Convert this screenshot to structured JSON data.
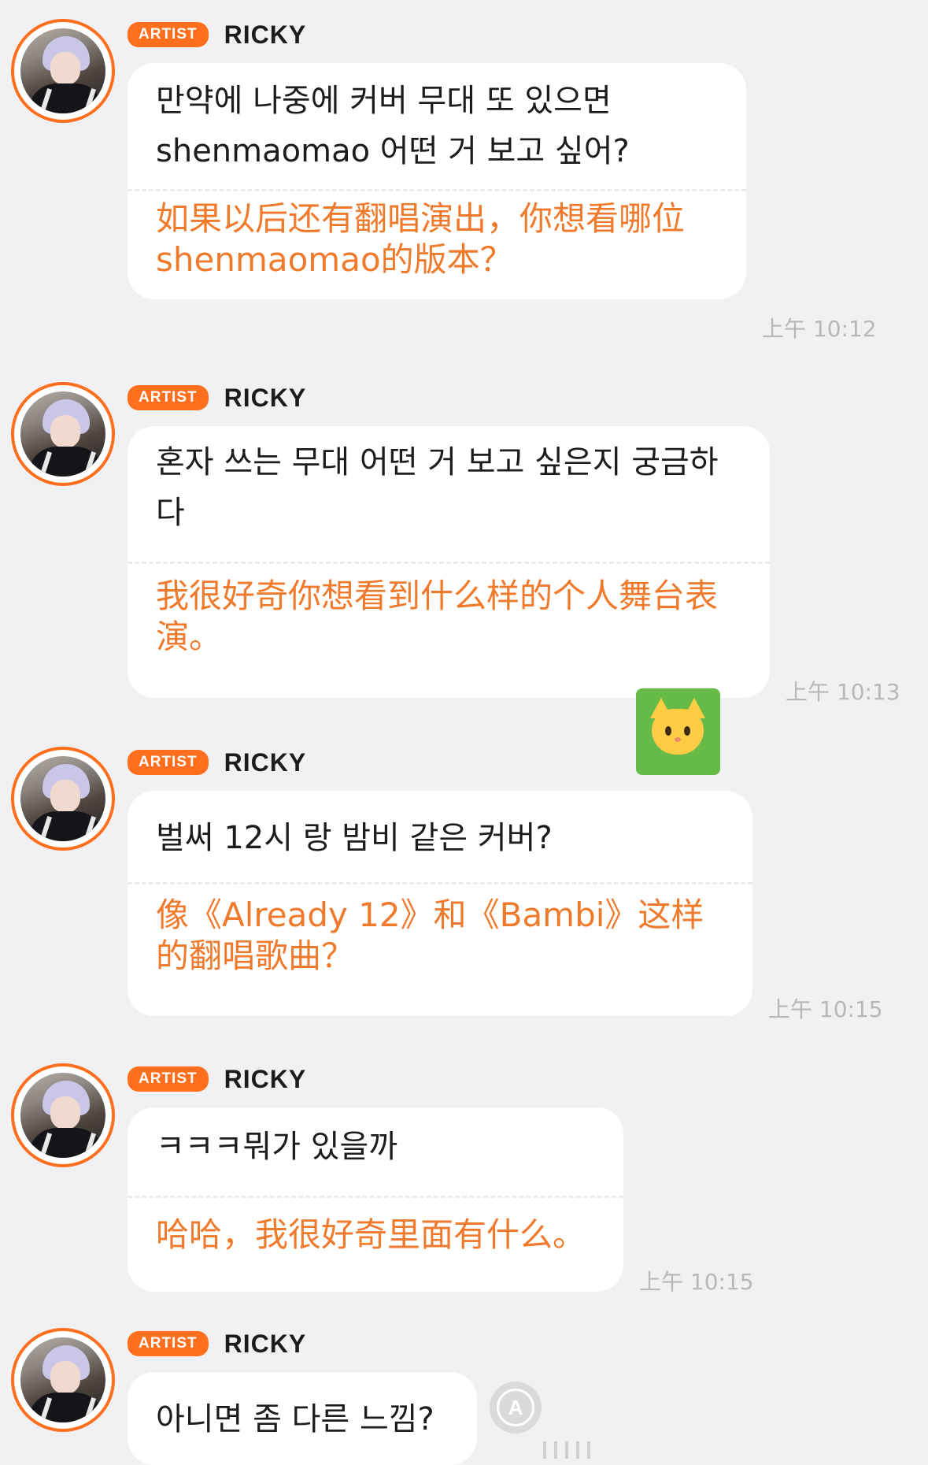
{
  "badge_label": "ARTIST",
  "sticker_icon": "cat-face-emoji",
  "accent_color": "#ff6f1e",
  "translation_color": "#f07a2c",
  "messages": [
    {
      "sender": "RICKY",
      "korean": "만약에 나중에 커버 무대 또 있으면 shenmaomao 어떤 거 보고 싶어?",
      "chinese": "如果以后还有翻唱演出，你想看哪位 shenmaomao的版本？",
      "time": "上午 10:12"
    },
    {
      "sender": "RICKY",
      "korean": "혼자 쓰는 무대 어떤 거 보고 싶은지 궁금하다",
      "chinese": "我很好奇你想看到什么样的个人舞台表演。",
      "time": "上午 10:13"
    },
    {
      "sender": "RICKY",
      "korean": "벌써 12시 랑 밤비 같은 커버?",
      "chinese": "像《Already 12》和《Bambi》这样的翻唱歌曲？",
      "time": "上午 10:15"
    },
    {
      "sender": "RICKY",
      "korean": "ㅋㅋㅋ뭐가 있을까",
      "chinese": "哈哈，我很好奇里面有什么。",
      "time": "上午 10:15"
    },
    {
      "sender": "RICKY",
      "korean": "아니면 좀 다른 느낌?"
    }
  ]
}
